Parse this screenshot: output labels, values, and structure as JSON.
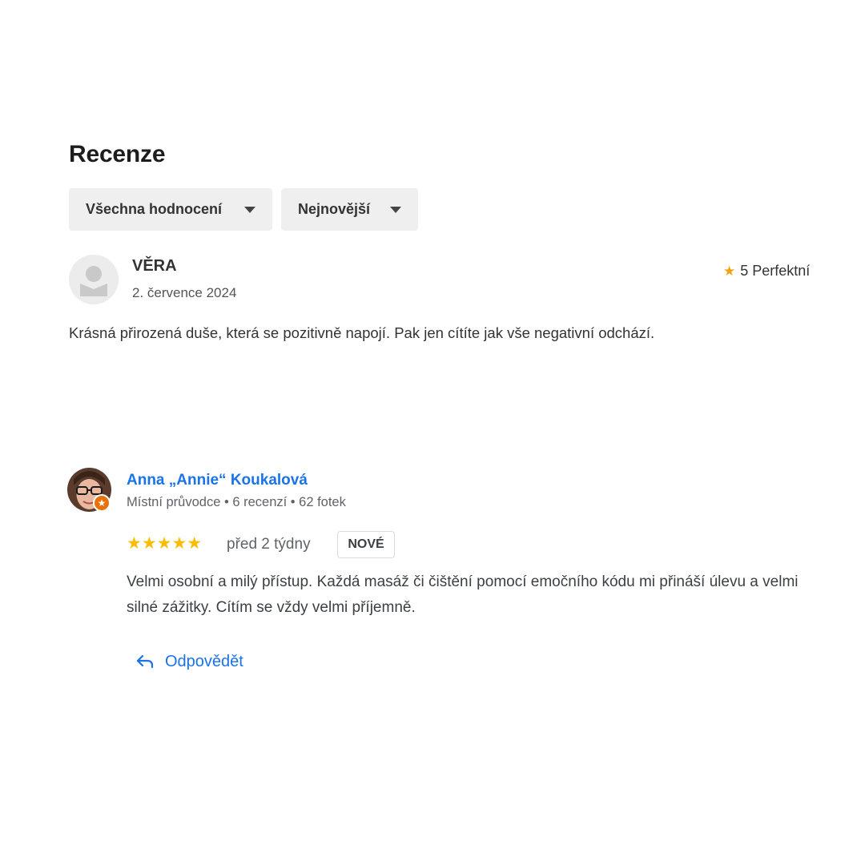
{
  "section": {
    "title": "Recenze"
  },
  "filters": {
    "all_label": "Všechna hodnocení",
    "sort_label": "Nejnovější"
  },
  "review1": {
    "name": "VĚRA",
    "date": "2. července 2024",
    "rating_text": "5 Perfektní",
    "text": "Krásná přirozená duše, která se pozitivně napojí. Pak jen cítíte jak vše negativní odchází."
  },
  "review2": {
    "name": "Anna „Annie“ Koukalová",
    "meta": "Místní průvodce • 6 recenzí • 62 fotek",
    "stars": "★★★★★",
    "rating": 5,
    "time": "před 2 týdny",
    "badge": "NOVÉ",
    "text": "Velmi osobní a milý přístup. Každá masáž či čištění pomocí emočního kódu mi přináší úlevu a velmi silné zážitky. Cítím se vždy velmi příjemně.",
    "reply_label": "Odpovědět"
  },
  "colors": {
    "accent": "#1a73e8",
    "star_yellow": "#fbbc04",
    "star_orange": "#f2a20d",
    "badge_orange": "#e8710a",
    "filter_bg": "#efefef"
  },
  "icons": {
    "caret": "chevron-down-icon",
    "star": "star-icon",
    "reply": "reply-arrow-icon",
    "local_guide": "local-guide-star-icon"
  }
}
